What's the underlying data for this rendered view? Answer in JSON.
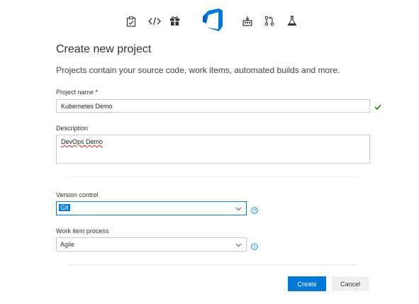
{
  "header": {
    "icons": [
      "work-items-icon",
      "code-icon",
      "packages-icon",
      "azure-devops-logo",
      "build-icon",
      "pull-request-icon",
      "test-plans-icon"
    ],
    "accent_color": "#0078d4"
  },
  "form": {
    "title": "Create new project",
    "subtitle": "Projects contain your source code, work items, automated builds and more.",
    "project_name": {
      "label": "Project name",
      "required_marker": "*",
      "value": "Kubernetes Demo",
      "valid": true
    },
    "description": {
      "label": "Description",
      "value": "DevOps Demo"
    },
    "version_control": {
      "label": "Version control",
      "value": "Git"
    },
    "work_item_process": {
      "label": "Work item process",
      "value": "Agile"
    },
    "buttons": {
      "create": "Create",
      "cancel": "Cancel"
    }
  }
}
